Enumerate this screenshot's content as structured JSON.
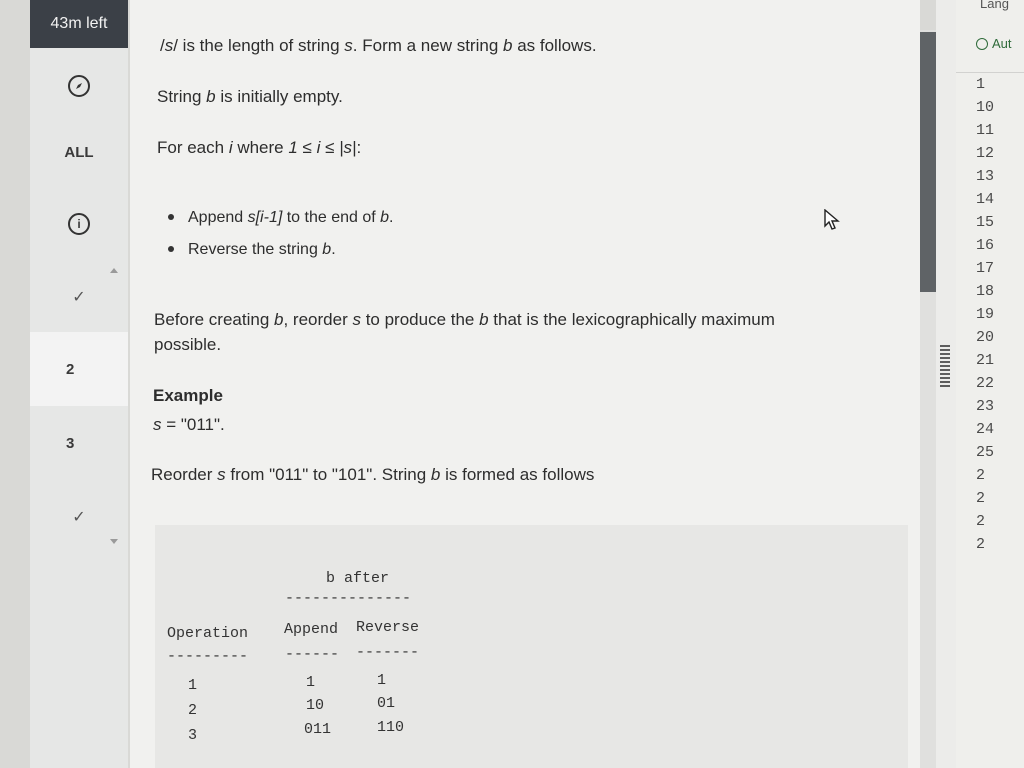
{
  "timer": "43m left",
  "sidebar": {
    "items": [
      {
        "label": "",
        "icon": "compass-icon"
      },
      {
        "label": "ALL"
      },
      {
        "label": "i",
        "icon": "info-icon"
      },
      {
        "label": "✓",
        "icon": "check-icon"
      },
      {
        "label": "2"
      },
      {
        "label": "3"
      },
      {
        "label": "✓",
        "icon": "check-icon"
      }
    ]
  },
  "problem": {
    "line1_pre": "/",
    "line1_var": "s",
    "line1_mid": "/ is the length of string ",
    "line1_var2": "s",
    "line1_post": ". Form a new string ",
    "line1_var3": "b",
    "line1_end": " as follows.",
    "line2_pre": "String ",
    "line2_var": "b",
    "line2_post": " is initially empty.",
    "line3_pre": "For each ",
    "line3_var": "i",
    "line3_post": " where ",
    "line3_cond": "1 ≤ i ≤ |s|",
    "line3_end": ":",
    "bullet1_pre": "Append ",
    "bullet1_var": "s[i-1]",
    "bullet1_mid": " to the end of ",
    "bullet1_var2": "b",
    "bullet1_end": ".",
    "bullet2_pre": "Reverse the string ",
    "bullet2_var": "b",
    "bullet2_end": ".",
    "para_pre": "Before creating ",
    "para_var1": "b",
    "para_mid1": ", reorder ",
    "para_var2": "s",
    "para_mid2": " to produce the ",
    "para_var3": "b",
    "para_mid3": " that is the lexicographically maximum",
    "para_line2": "possible.",
    "example_title": "Example",
    "example_var": "s",
    "example_val": " = \"011\".",
    "reorder_pre": "Reorder ",
    "reorder_var": "s",
    "reorder_mid": " from \"011\" to \"101\". String ",
    "reorder_var2": "b",
    "reorder_end": " is formed as follows"
  },
  "table": {
    "group_header": "b after",
    "group_rule": "--------------",
    "col_operation": "Operation",
    "col_append": "Append",
    "col_reverse": "Reverse",
    "rule_operation": "---------",
    "rule_append": "------",
    "rule_reverse": "-------",
    "rows": [
      {
        "op": "1",
        "append": "1",
        "reverse": "1"
      },
      {
        "op": "2",
        "append": "10",
        "reverse": "01"
      },
      {
        "op": "3",
        "append": "011",
        "reverse": "110"
      }
    ]
  },
  "editor": {
    "language_label": "Lang",
    "autosave_label": "Aut",
    "line_numbers": [
      "1",
      "10",
      "11",
      "12",
      "13",
      "14",
      "15",
      "16",
      "17",
      "18",
      "19",
      "20",
      "21",
      "22",
      "23",
      "24",
      "25",
      "2",
      "2",
      "2",
      "2"
    ]
  }
}
